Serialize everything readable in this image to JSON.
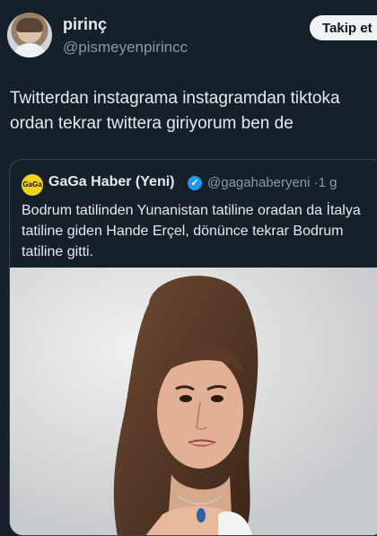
{
  "author": {
    "name": "pirinç",
    "handle": "@pismeyenpirincc",
    "follow_label": "Takip et"
  },
  "tweet": {
    "text": "Twitterdan instagrama instagramdan tiktoka ordan tekrar twittera giriyorum ben de"
  },
  "quote": {
    "logo_text": "GaGa",
    "name": "GaGa Haber (Yeni)",
    "handle": "@gagahaberyeni",
    "separator": "·",
    "time": "1 g",
    "text": "Bodrum tatilinden Yunanistan tatiline oradan da İtalya tatiline giden Hande Erçel, dönünce tekrar Bodrum tatiline gitti.",
    "verified_icon": "check-badge-icon"
  }
}
